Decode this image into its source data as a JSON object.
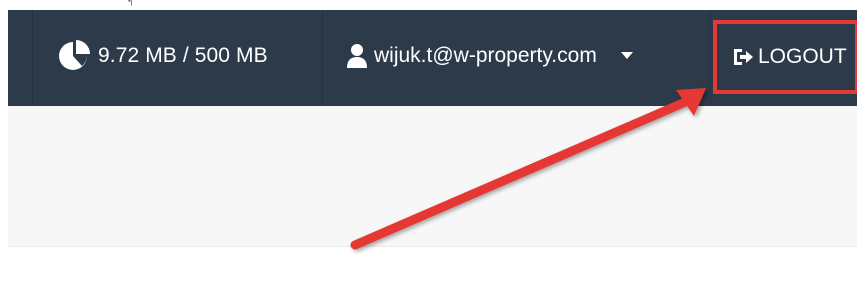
{
  "navbar": {
    "storage": {
      "icon": "pie-chart-icon",
      "text": "9.72 MB / 500 MB"
    },
    "user": {
      "icon": "user-icon",
      "email": "wijuk.t@w-property.com",
      "dropdown_icon": "caret-down-icon"
    },
    "logout": {
      "icon": "sign-out-icon",
      "label": "LOGOUT"
    }
  },
  "annotation": {
    "highlight_color": "#e53935",
    "arrow_color": "#e53935"
  }
}
